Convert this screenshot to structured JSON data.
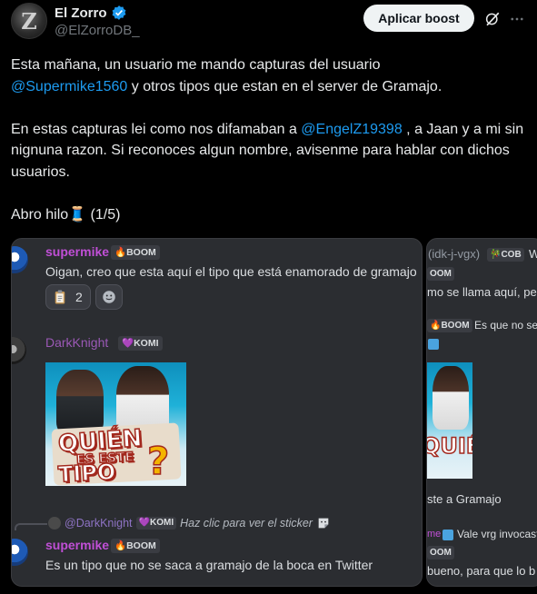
{
  "author": {
    "display_name": "El Zorro",
    "handle": "@ElZorroDB_",
    "avatar_letter": "Z"
  },
  "actions": {
    "boost_label": "Aplicar boost",
    "grok_icon": "grok-icon",
    "more_icon": "more-icon"
  },
  "tweet": {
    "p1_a": "Esta mañana, un usuario me mando capturas del usuario",
    "p1_mention": "@Supermike1560",
    "p1_b": " y otros tipos que estan en el server de Gramajo.",
    "p2_a": "En estas capturas lei como nos difamaban a ",
    "p2_mention": "@EngelZ19398",
    "p2_b": " , a Jaan y a mi sin nignuna razon. Si reconoces algun nombre, avisenme para hablar con dichos usuarios.",
    "p3": "Abro hilo🧵 (1/5)"
  },
  "screenshot_left": {
    "msg1_user": "supermike",
    "msg1_tag": "🔥BOOM",
    "msg1_text": "Oigan, creo que esta aquí el tipo que está enamorado de gramajo",
    "reaction_count": "2",
    "msg2_user": "DarkKnight",
    "msg2_tag": "💜KOMI",
    "meme_line1": "QUIÉN",
    "meme_line2": "ES ESTE",
    "meme_line3": "TIPO",
    "meme_q": "?",
    "reply_user": "@DarkKnight",
    "reply_tag": "💜KOMI",
    "reply_text": "Haz clic para ver el sticker",
    "msg3_user": "supermike",
    "msg3_tag": "🔥BOOM",
    "msg3_text": "Es un tipo que no se saca a gramajo de la boca en Twitter"
  },
  "screenshot_right": {
    "user": "(idk-j-vgx)",
    "tag1": "🎋COB",
    "tag1_after": "W",
    "tag2": "OOM",
    "line1": "mo se llama aquí, pe",
    "tag3": "🔥BOOM",
    "line2": "Es que no se c",
    "line3": "ste a Gramajo",
    "line4_prefix": "me",
    "line4": "Vale vrg invocast",
    "tag4": "OOM",
    "line5": "bueno, para que lo b",
    "meme_text": "QUIÉN"
  },
  "colors": {
    "mention": "#1d9bf0",
    "discord_bg": "#2b2d31",
    "username_purple": "#c04fd6"
  }
}
